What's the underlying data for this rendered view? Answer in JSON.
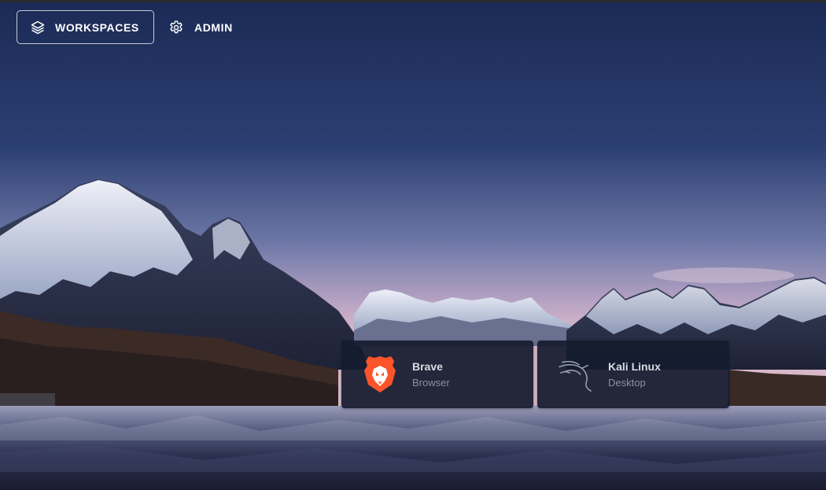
{
  "nav": {
    "workspaces_label": "WORKSPACES",
    "admin_label": "ADMIN",
    "workspaces_icon": "layers-icon",
    "admin_icon": "gear-icon"
  },
  "workspaces": [
    {
      "title": "Brave",
      "subtitle": "Browser",
      "icon": "brave-lion-icon",
      "accent": "#fb542b"
    },
    {
      "title": "Kali Linux",
      "subtitle": "Desktop",
      "icon": "kali-dragon-icon",
      "accent": "#9aa3b2"
    }
  ],
  "colors": {
    "card_background": "#161c2e",
    "sky_top": "#1b2a55",
    "sky_horizon": "#b9a4c4"
  }
}
